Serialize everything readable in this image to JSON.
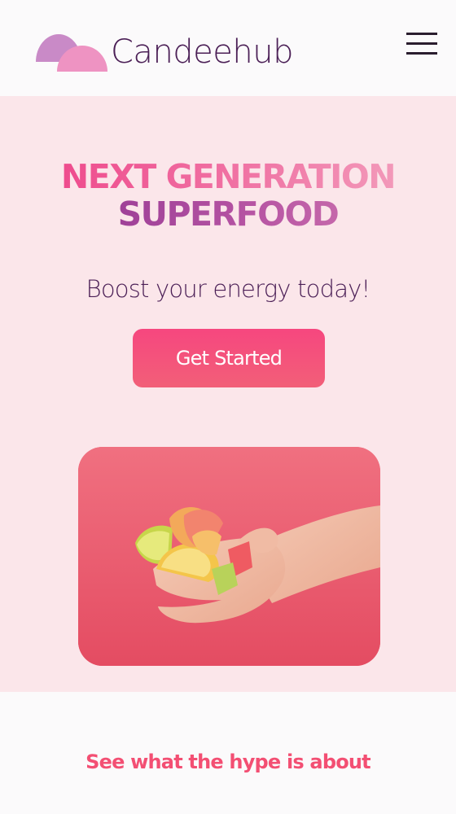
{
  "brand": {
    "name": "Candeehub",
    "logo_icon": "cloud-logo-icon"
  },
  "header": {
    "menu_icon": "hamburger-menu-icon"
  },
  "hero": {
    "title_line1": "NEXT GENERATION",
    "title_line2": "SUPERFOOD",
    "subtitle": "Boost your energy today!",
    "cta_label": "Get Started",
    "image_icon": "candy-hand-photo"
  },
  "section": {
    "heading": "See what the hype is about"
  },
  "colors": {
    "background": "#fbfafb",
    "hero_background": "#fbe6ea",
    "brand_text": "#4b1f56",
    "accent_pink": "#f6477f",
    "heading_pink": "#f34f73"
  }
}
